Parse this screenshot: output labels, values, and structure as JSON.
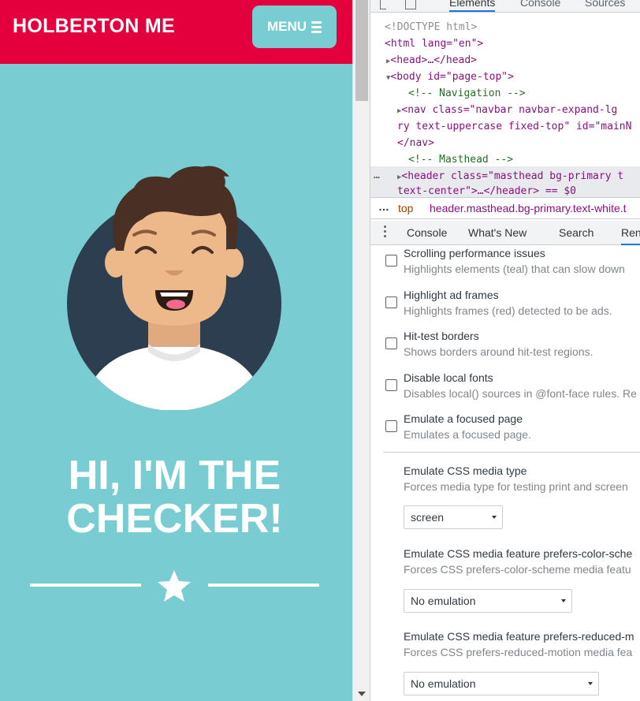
{
  "site": {
    "brand": "HOLBERTON ME",
    "menu_label": "MENU",
    "hero_title_line1": "HI, I'M THE",
    "hero_title_line2": "CHECKER!",
    "colors": {
      "navbar": "#e3003c",
      "masthead": "#78ccd2",
      "avatar_bg": "#2c3e50"
    }
  },
  "devtools": {
    "tabs": [
      "Elements",
      "Console",
      "Sources"
    ],
    "active_tab": "Elements",
    "elements_tree": {
      "doctype": "<!DOCTYPE html>",
      "html_open": "<html lang=\"en\">",
      "head": "<head>…</head>",
      "body_open": "<body id=\"page-top\">",
      "comment_nav": "<!-- Navigation -->",
      "nav_line1": "<nav class=\"navbar navbar-expand-lg ",
      "nav_line2": "ry text-uppercase fixed-top\" id=\"mainN",
      "nav_close": "</nav>",
      "comment_masthead": "<!-- Masthead -->",
      "header_line1": "<header class=\"masthead bg-primary t",
      "header_line2": "text-center\">…</header> == $0"
    },
    "breadcrumb": {
      "dots": "…",
      "top": "top",
      "path": "header.masthead.bg-primary.text-white.t"
    },
    "drawer_tabs": [
      "Console",
      "What's New",
      "Search",
      "Ren"
    ],
    "rendering_options": [
      {
        "title": "Scrolling performance issues",
        "desc": "Highlights elements (teal) that can slow down"
      },
      {
        "title": "Highlight ad frames",
        "desc": "Highlights frames (red) detected to be ads."
      },
      {
        "title": "Hit-test borders",
        "desc": "Shows borders around hit-test regions."
      },
      {
        "title": "Disable local fonts",
        "desc": "Disables local() sources in @font-face rules. Re"
      },
      {
        "title": "Emulate a focused page",
        "desc": "Emulates a focused page."
      }
    ],
    "media_emulation": [
      {
        "title": "Emulate CSS media type",
        "desc": "Forces media type for testing print and screen",
        "value": "screen"
      },
      {
        "title": "Emulate CSS media feature prefers-color-sche",
        "desc": "Forces CSS prefers-color-scheme media featu",
        "value": "No emulation"
      },
      {
        "title": "Emulate CSS media feature prefers-reduced-m",
        "desc": "Forces CSS prefers-reduced-motion media fea",
        "value": "No emulation"
      }
    ]
  }
}
